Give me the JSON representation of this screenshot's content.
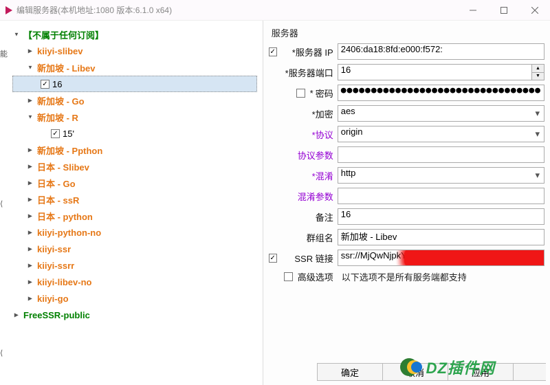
{
  "window": {
    "title": "编辑服务器(本机地址:1080 版本:6.1.0 x64)"
  },
  "tree": {
    "root": "【不属于任何订阅】",
    "n1": "kiiyi-slibev",
    "n2": "新加坡 - Libev",
    "n2a": "16",
    "n3": "新加坡 - Go",
    "n4": "新加坡 - R",
    "n4a": "15'",
    "n5": "新加坡 - Ppthon",
    "n6": "日本 - Slibev",
    "n7": "日本 - Go",
    "n8": "日本 - ssR",
    "n9": "日本 - python",
    "n10": "kiiyi-python-no",
    "n11": "kiiyi-ssr",
    "n12": "kiiyi-ssrr",
    "n13": "kiiyi-libev-no",
    "n14": "kiiyi-go",
    "n15": "FreeSSR-public"
  },
  "form": {
    "group_title": "服务器",
    "ip_label": "服务器 IP",
    "ip_value": "2406:da18:8fd:e000:f572:",
    "port_label": "服务器端口",
    "port_value": "16",
    "pw_label": "密码",
    "pw_value": "●●●●●●●●●●●●●●●●●●●●●●●●●●●●●●●●●",
    "enc_label": "加密",
    "enc_value": "aes",
    "proto_label": "协议",
    "proto_value": "origin",
    "proto_param_label": "协议参数",
    "proto_param_value": "",
    "obfs_label": "混淆",
    "obfs_value": "http",
    "obfs_param_label": "混淆参数",
    "obfs_param_value": "",
    "remark_label": "备注",
    "remark_value": "16",
    "groupname_label": "群组名",
    "groupname_value": "新加坡 - Libev",
    "ssr_label": "SSR 链接",
    "ssr_value": "ssr://MjQwNjpkYT",
    "adv_label": "高级选项",
    "adv_text": "以下选项不是所有服务端都支持"
  },
  "buttons": {
    "ok": "确定",
    "cancel": "取消",
    "apply": "应用"
  },
  "optional_edge": {
    "a": "能",
    "b": "⟨",
    "c": "⟨"
  },
  "watermark": "DZ插件网"
}
